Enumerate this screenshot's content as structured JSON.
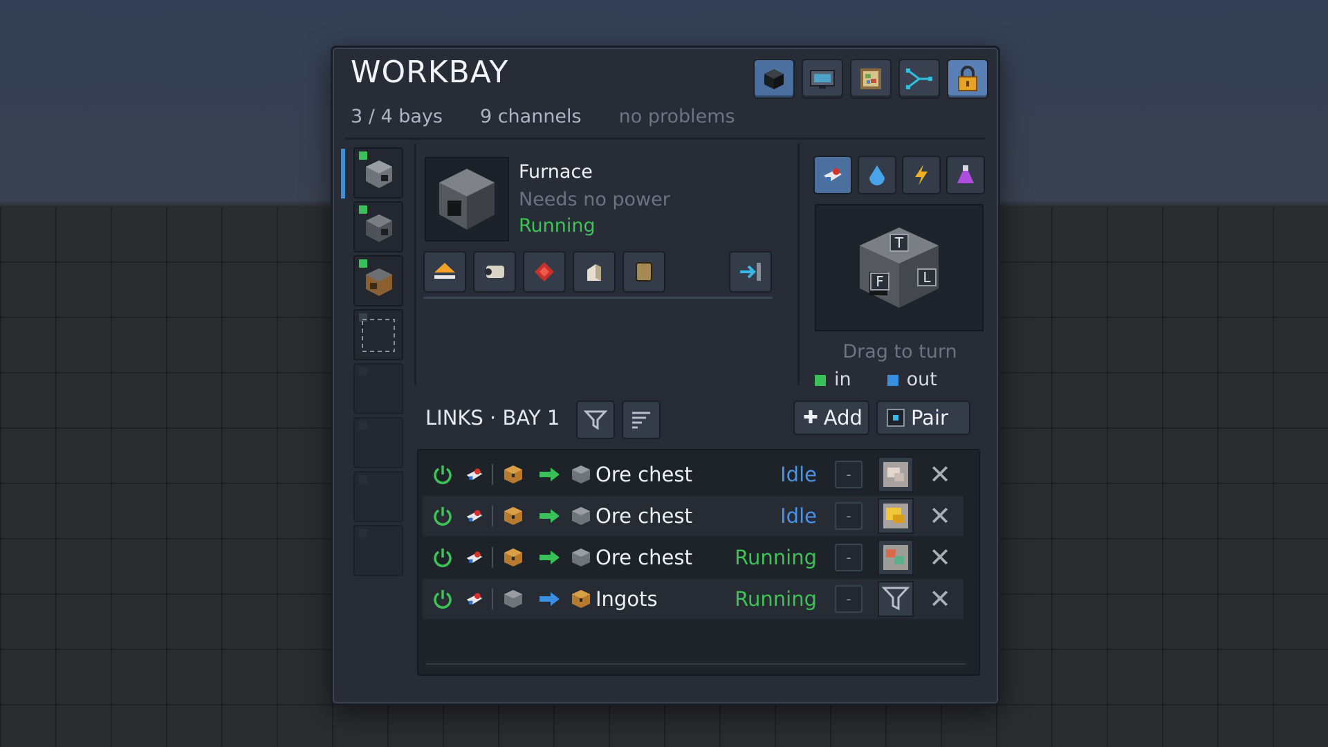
{
  "header": {
    "title": "WORKBAY"
  },
  "toolbar": {
    "items": [
      {
        "icon": "cube-icon",
        "active": true
      },
      {
        "icon": "monitor-icon",
        "active": false
      },
      {
        "icon": "map-icon",
        "active": false
      },
      {
        "icon": "network-icon",
        "active": false
      },
      {
        "icon": "lock-icon",
        "active": true
      }
    ]
  },
  "summary": {
    "bays": "3 / 4 bays",
    "channels": "9 channels",
    "problems": "no problems"
  },
  "bays": [
    {
      "state": "active",
      "selected": true,
      "icon": "furnace-icon"
    },
    {
      "state": "active",
      "selected": false,
      "icon": "furnace-icon"
    },
    {
      "state": "active",
      "selected": false,
      "icon": "crafting-icon"
    },
    {
      "state": "empty",
      "selected": false,
      "icon": "empty-slot-icon"
    },
    {
      "state": "locked",
      "icon": ""
    },
    {
      "state": "locked",
      "icon": ""
    },
    {
      "state": "locked",
      "icon": ""
    },
    {
      "state": "locked",
      "icon": ""
    }
  ],
  "machine": {
    "name": "Furnace",
    "power": "Needs no power",
    "status": "Running",
    "upgrades": [
      "eject-icon",
      "scroll-icon",
      "ruby-icon",
      "ladder-icon",
      "barrel-icon",
      "export-icon"
    ]
  },
  "channels": [
    {
      "icon": "item-channel-icon",
      "active": true
    },
    {
      "icon": "fluid-channel-icon",
      "active": false
    },
    {
      "icon": "energy-channel-icon",
      "active": false
    },
    {
      "icon": "potion-channel-icon",
      "active": false
    }
  ],
  "preview": {
    "faces": [
      "T",
      "F",
      "L"
    ],
    "hint": "Drag to turn",
    "legend_in": "in",
    "legend_out": "out"
  },
  "links": {
    "title": "LINKS · BAY 1",
    "add_label": "Add",
    "pair_label": "Pair",
    "rows": [
      {
        "name": "Ore chest",
        "status": "Idle",
        "direction": "in",
        "filter": "iron-ore-icon"
      },
      {
        "name": "Ore chest",
        "status": "Idle",
        "direction": "in",
        "filter": "gold-ore-icon"
      },
      {
        "name": "Ore chest",
        "status": "Running",
        "direction": "in",
        "filter": "copper-ore-icon"
      },
      {
        "name": "Ingots",
        "status": "Running",
        "direction": "out",
        "filter": "funnel-icon"
      }
    ],
    "minus_label": "-"
  },
  "colors": {
    "running": "#3dc356",
    "idle": "#4a93e6",
    "in": "#39c05a",
    "out": "#3a8ee0"
  }
}
